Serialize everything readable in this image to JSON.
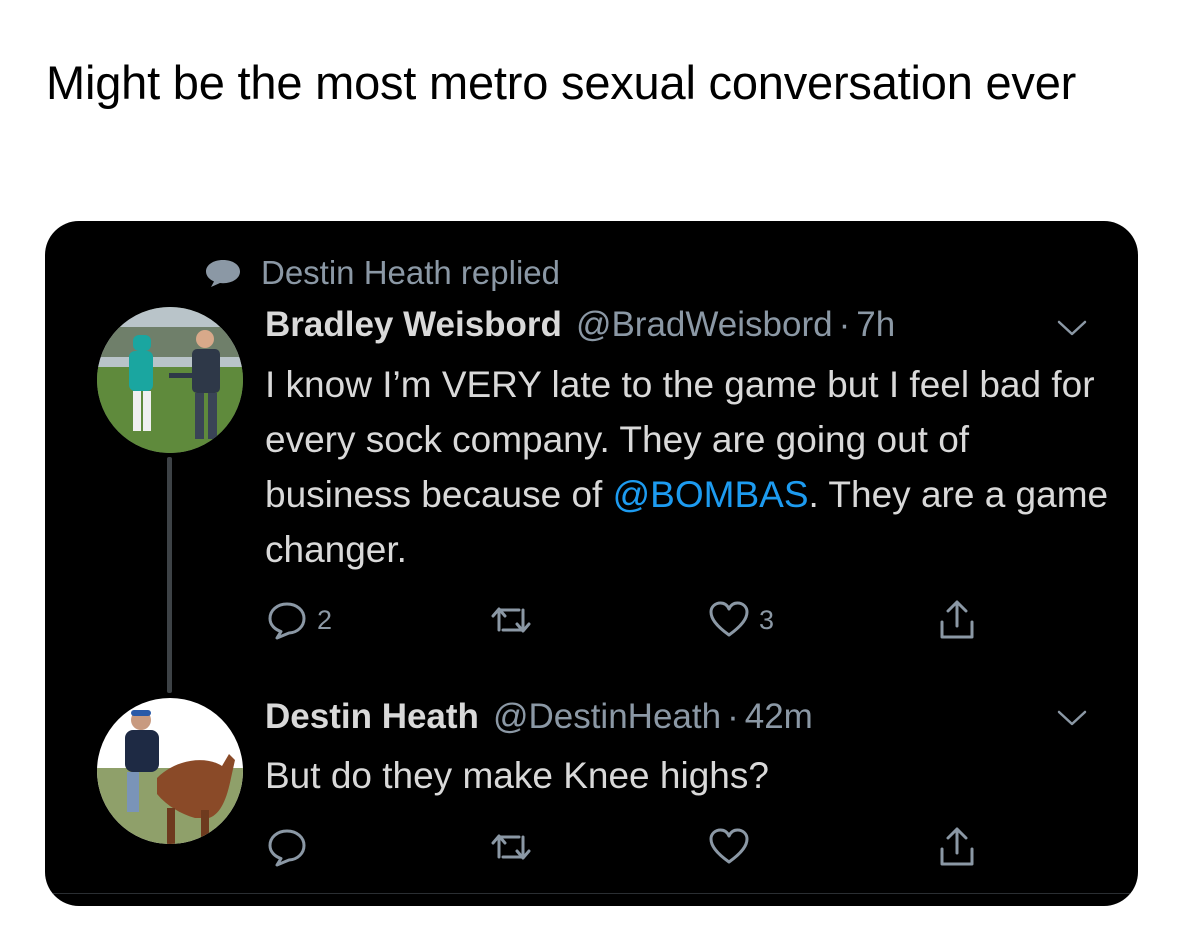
{
  "caption": "Might be the most metro sexual conversation ever",
  "context": {
    "text": "Destin Heath replied",
    "icon": "speech-bubble-icon"
  },
  "tweets": [
    {
      "name": "Bradley Weisbord",
      "handle": "@BradWeisbord",
      "separator": "·",
      "time": "7h",
      "text_before": "I know I’m VERY late to the game but I feel bad for every sock company. They are going out of business because of ",
      "mention": "@BOMBAS",
      "text_after": ". They are a game changer.",
      "reply_count": "2",
      "retweet_count": "",
      "like_count": "3"
    },
    {
      "name": "Destin Heath",
      "handle": "@DestinHeath",
      "separator": "·",
      "time": "42m",
      "text_before": "But do they make Knee highs?",
      "reply_count": "",
      "retweet_count": "",
      "like_count": ""
    }
  ],
  "colors": {
    "card_bg": "#000000",
    "text": "#d9d9d9",
    "muted": "#8b98a5",
    "link": "#1d9bf0"
  }
}
